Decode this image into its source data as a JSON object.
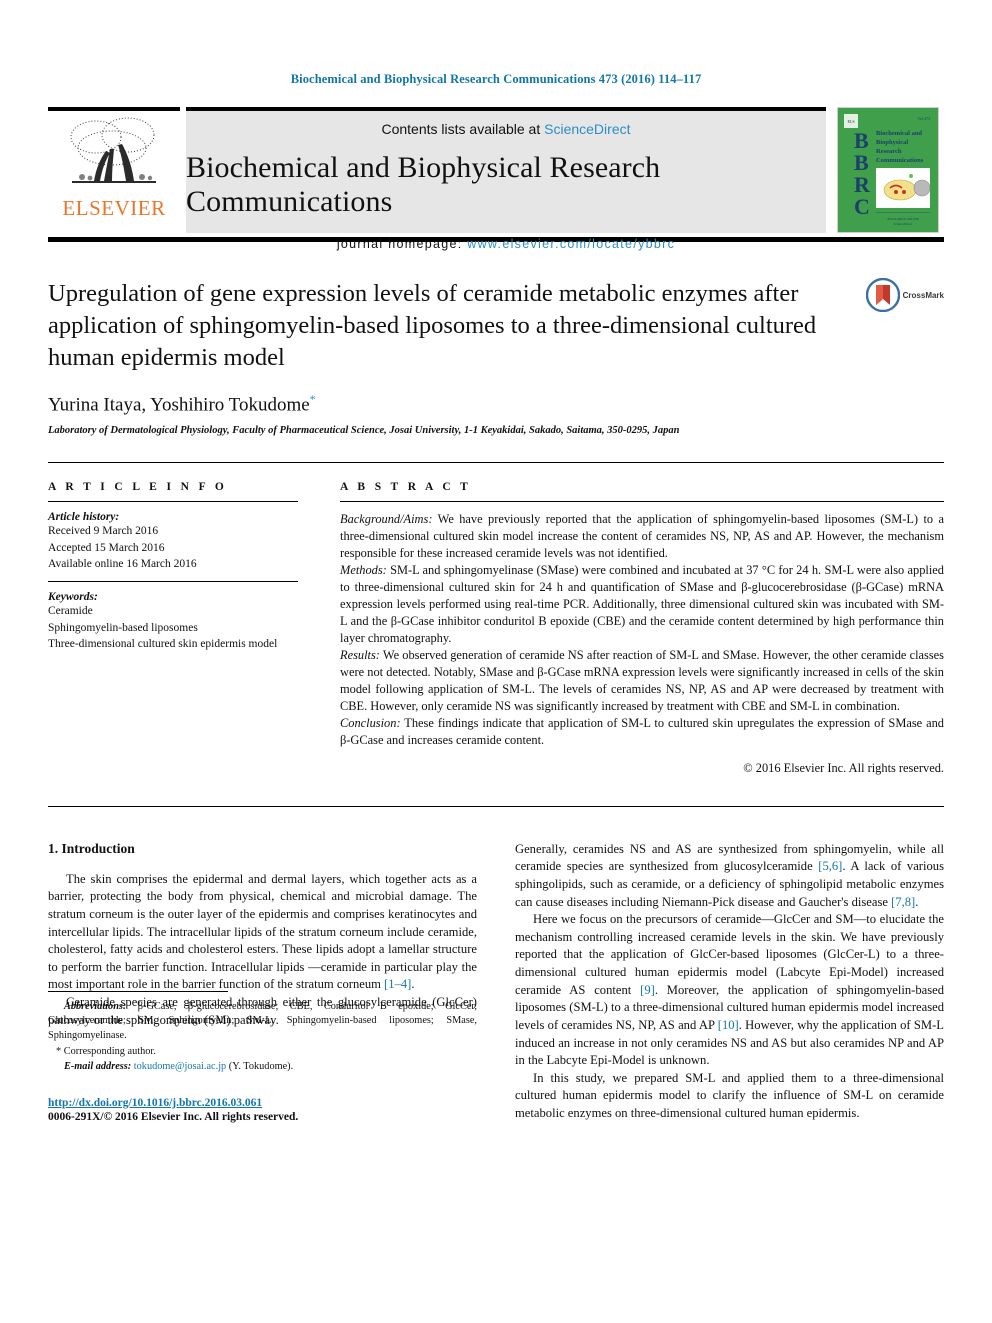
{
  "running_head": "Biochemical and Biophysical Research Communications 473 (2016) 114–117",
  "masthead": {
    "publisher": "ELSEVIER",
    "contents_prefix": "Contents lists available at ",
    "contents_link": "ScienceDirect",
    "journal_title": "Biochemical and Biophysical Research Communications",
    "homepage_prefix": "journal homepage: ",
    "homepage_url": "www.elsevier.com/locate/ybbrc",
    "cover_title_lines": [
      "Biochemical and",
      "Biophysical",
      "Research",
      "Communications"
    ],
    "cover_letters": [
      "B",
      "B",
      "R",
      "C"
    ],
    "cover_color": "#3f9f4a"
  },
  "article": {
    "title": "Upregulation of gene expression levels of ceramide metabolic enzymes after application of sphingomyelin-based liposomes to a three-dimensional cultured human epidermis model",
    "authors": "Yurina Itaya, Yoshihiro Tokudome",
    "corresponding_marker": "*",
    "affiliation": "Laboratory of Dermatological Physiology, Faculty of Pharmaceutical Science, Josai University, 1-1 Keyakidai, Sakado, Saitama, 350-0295, Japan",
    "crossmark_label": "CrossMark"
  },
  "article_info": {
    "heading": "A R T I C L E   I N F O",
    "history_label": "Article history:",
    "history": [
      "Received 9 March 2016",
      "Accepted 15 March 2016",
      "Available online 16 March 2016"
    ],
    "keywords_label": "Keywords:",
    "keywords": [
      "Ceramide",
      "Sphingomyelin-based liposomes",
      "Three-dimensional cultured skin epidermis model"
    ]
  },
  "abstract": {
    "heading": "A B S T R A C T",
    "sections": [
      {
        "lead": "Background/Aims:",
        "text": " We have previously reported that the application of sphingomyelin-based liposomes (SM-L) to a three-dimensional cultured skin model increase the content of ceramides NS, NP, AS and AP. However, the mechanism responsible for these increased ceramide levels was not identified."
      },
      {
        "lead": "Methods:",
        "text": " SM-L and sphingomyelinase (SMase) were combined and incubated at 37 °C for 24 h. SM-L were also applied to three-dimensional cultured skin for 24 h and quantification of SMase and β-glucocerebrosidase (β-GCase) mRNA expression levels performed using real-time PCR. Additionally, three dimensional cultured skin was incubated with SM-L and the β-GCase inhibitor conduritol B epoxide (CBE) and the ceramide content determined by high performance thin layer chromatography."
      },
      {
        "lead": "Results:",
        "text": " We observed generation of ceramide NS after reaction of SM-L and SMase. However, the other ceramide classes were not detected. Notably, SMase and β-GCase mRNA expression levels were significantly increased in cells of the skin model following application of SM-L. The levels of ceramides NS, NP, AS and AP were decreased by treatment with CBE. However, only ceramide NS was significantly increased by treatment with CBE and SM-L in combination."
      },
      {
        "lead": "Conclusion:",
        "text": " These findings indicate that application of SM-L to cultured skin upregulates the expression of SMase and β-GCase and increases ceramide content."
      }
    ],
    "copyright": "© 2016 Elsevier Inc. All rights reserved."
  },
  "body": {
    "section_heading": "1. Introduction",
    "left_paragraphs": [
      {
        "segments": [
          {
            "t": "The skin comprises the epidermal and dermal layers, which together acts as a barrier, protecting the body from physical, chemical and microbial damage. The stratum corneum is the outer layer of the epidermis and comprises keratinocytes and intercellular lipids. The intracellular lipids of the stratum corneum include ceramide, cholesterol, fatty acids and cholesterol esters. These lipids adopt a lamellar structure to perform the barrier function. Intracellular lipids —ceramide in particular play the most important role in the barrier function of the stratum corneum "
          },
          {
            "t": "[1–4]",
            "ref": true
          },
          {
            "t": "."
          }
        ]
      },
      {
        "segments": [
          {
            "t": "Ceramide species are generated through either the glucosylceramide (GlcCer) pathway or the sphingomyelin (SM) pathway."
          }
        ]
      }
    ],
    "right_paragraphs": [
      {
        "segments": [
          {
            "t": "Generally, ceramides NS and AS are synthesized from sphingomyelin, while all ceramide species are synthesized from glucosylceramide "
          },
          {
            "t": "[5,6]",
            "ref": true
          },
          {
            "t": ". A lack of various sphingolipids, such as ceramide, or a deficiency of sphingolipid metabolic enzymes can cause diseases including Niemann-Pick disease and Gaucher's disease "
          },
          {
            "t": "[7,8]",
            "ref": true
          },
          {
            "t": "."
          }
        ],
        "noindent": true
      },
      {
        "segments": [
          {
            "t": "Here we focus on the precursors of ceramide—GlcCer and SM—to elucidate the mechanism controlling increased ceramide levels in the skin. We have previously reported that the application of GlcCer-based liposomes (GlcCer-L) to a three-dimensional cultured human epidermis model (Labcyte Epi-Model) increased ceramide AS content "
          },
          {
            "t": "[9]",
            "ref": true
          },
          {
            "t": ". Moreover, the application of sphingomyelin-based liposomes (SM-L) to a three-dimensional cultured human epidermis model increased levels of ceramides NS, NP, AS and AP "
          },
          {
            "t": "[10]",
            "ref": true
          },
          {
            "t": ". However, why the application of SM-L induced an increase in not only ceramides NS and AS but also ceramides NP and AP in the Labcyte Epi-Model is unknown."
          }
        ]
      },
      {
        "segments": [
          {
            "t": "In this study, we prepared SM-L and applied them to a three-dimensional cultured human epidermis model to clarify the influence of SM-L on ceramide metabolic enzymes on three-dimensional cultured human epidermis."
          }
        ]
      }
    ]
  },
  "footnotes": {
    "abbrev_label": "Abbreviations:",
    "abbrev_text": " β-GCase, β-glucocerebrosidase; CBE, Conduritol B epoxide; GlcCer, Glucosylceramide; SM, Sphingomyelin; SM-L, Sphingomyelin-based liposomes; SMase, Sphingomyelinase.",
    "corresponding": "* Corresponding author.",
    "email_label": "E-mail address:",
    "email": "tokudome@josai.ac.jp",
    "email_suffix": " (Y. Tokudome).",
    "doi": "http://dx.doi.org/10.1016/j.bbrc.2016.03.061",
    "issn": "0006-291X/© 2016 Elsevier Inc. All rights reserved."
  },
  "colors": {
    "link": "#1277a8",
    "sciencedirect": "#2b8fc4",
    "elsevier_orange": "#e8762c",
    "band_gray": "#e6e6e6"
  }
}
